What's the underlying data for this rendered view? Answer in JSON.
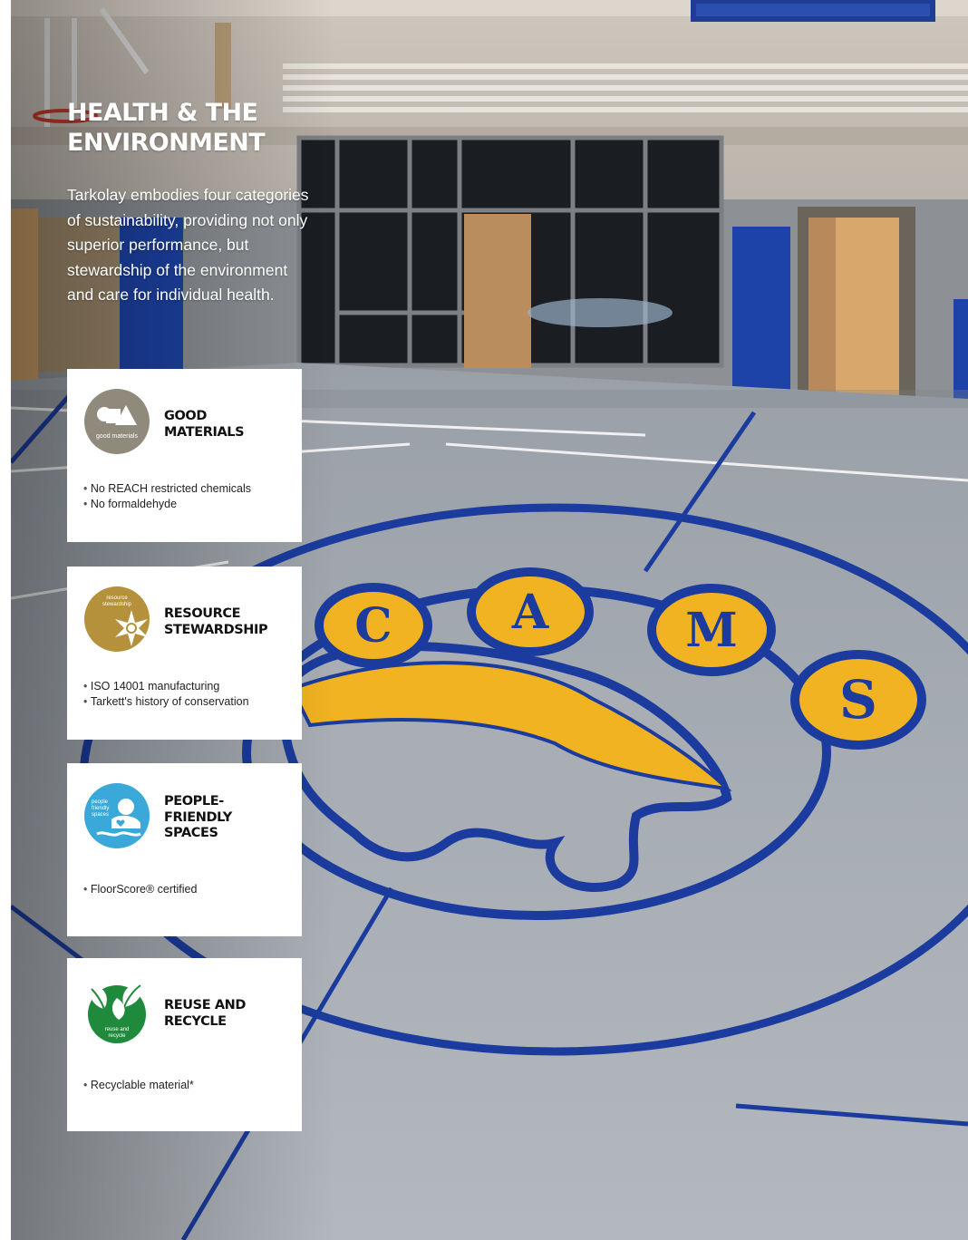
{
  "heading": {
    "line1": "HEALTH & THE",
    "line2": "ENVIRONMENT"
  },
  "intro": "Tarkolay embodies four categories of sustainability, providing not only superior performance, but stewardship of the environment and care for individual health.",
  "photo": {
    "floor_letters": [
      "C",
      "A",
      "M",
      "S"
    ]
  },
  "cards": [
    {
      "icon": "good-materials-icon",
      "icon_text": "good materials",
      "icon_color": "#8f8a7c",
      "title_line1": "GOOD",
      "title_line2": "MATERIALS",
      "title_line3": "",
      "items": [
        "No REACH restricted chemicals",
        "No formaldehyde"
      ]
    },
    {
      "icon": "resource-stewardship-icon",
      "icon_text_line1": "resource",
      "icon_text_line2": "stewardship",
      "icon_color": "#b5913c",
      "title_line1": "RESOURCE",
      "title_line2": "STEWARDSHIP",
      "title_line3": "",
      "items": [
        "ISO 14001 manufacturing",
        "Tarkett's history of conservation"
      ]
    },
    {
      "icon": "people-friendly-spaces-icon",
      "icon_text_line1": "people",
      "icon_text_line2": "friendly",
      "icon_text_line3": "spaces",
      "icon_color": "#3aa8d8",
      "title_line1": "PEOPLE-",
      "title_line2": "FRIENDLY",
      "title_line3": "SPACES",
      "items": [
        "FloorScore® certified"
      ]
    },
    {
      "icon": "reuse-and-recycle-icon",
      "icon_text_line1": "reuse and",
      "icon_text_line2": "recycle",
      "icon_color": "#1f8a3c",
      "title_line1": "REUSE AND",
      "title_line2": "RECYCLE",
      "title_line3": "",
      "items": [
        "Recyclable material*"
      ]
    }
  ]
}
